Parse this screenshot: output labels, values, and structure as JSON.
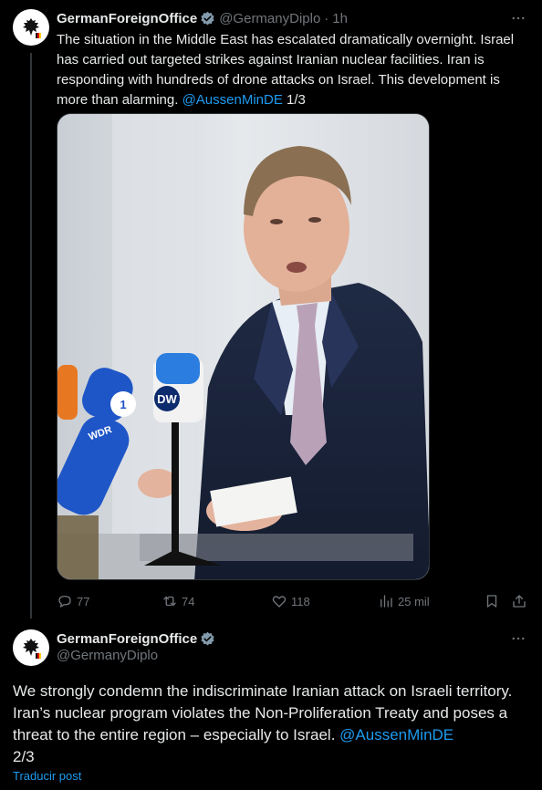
{
  "tweet1": {
    "author_name": "GermanForeignOffice",
    "handle": "@GermanyDiplo",
    "separator": "·",
    "time": "1h",
    "text_main": "The situation in the Middle East has escalated dramatically overnight. Israel has carried out targeted strikes against Iranian nuclear facilities. Iran is responding with hundreds of drone attacks on Israel. This development is more than alarming.",
    "mention": "@AussenMinDE",
    "thread_index": "1/3",
    "media": {
      "mic_labels": [
        "DW",
        "WDR",
        "1"
      ]
    },
    "actions": {
      "replies": "77",
      "reposts": "74",
      "likes": "118",
      "views": "25 mil"
    }
  },
  "tweet2": {
    "author_name": "GermanForeignOffice",
    "handle": "@GermanyDiplo",
    "text_main": "We strongly condemn the indiscriminate Iranian attack on Israeli territory. Iran’s nuclear program violates the Non-Proliferation Treaty and poses a threat to the entire region – especially to Israel.",
    "mention": "@AussenMinDE",
    "thread_index": "2/3",
    "translate_label": "Traducir post"
  },
  "colors": {
    "background": "#000000",
    "text": "#e7e9ea",
    "muted": "#71767b",
    "accent": "#1d9bf0",
    "verified": "#829aab"
  },
  "icons": [
    "eagle-emblem-icon",
    "verified-badge-icon",
    "more-icon",
    "reply-icon",
    "repost-icon",
    "like-icon",
    "views-icon",
    "bookmark-icon",
    "share-icon"
  ]
}
